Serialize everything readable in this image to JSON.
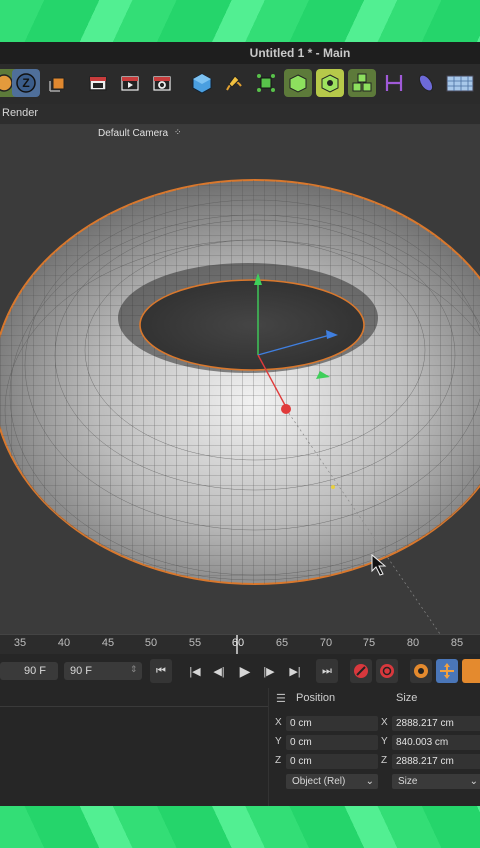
{
  "window": {
    "title": "Untitled 1 * - Main"
  },
  "menubar": {
    "render_label": "Render"
  },
  "viewport": {
    "camera_label": "Default Camera"
  },
  "toolbar": {
    "icons": [
      "mode-icon",
      "z-axis-icon",
      "cube-object-icon",
      "clapboard-icon",
      "render-icon",
      "render-settings-icon",
      "cube-primitive-icon",
      "pen-spline-icon",
      "generator-icon",
      "deformer-icon",
      "subdivision-icon",
      "cloner-icon",
      "measure-icon",
      "capsule-icon",
      "floor-icon"
    ]
  },
  "timeline": {
    "ticks": [
      "35",
      "40",
      "45",
      "50",
      "55",
      "60",
      "65",
      "70",
      "75",
      "80",
      "85"
    ],
    "current": "60"
  },
  "transport": {
    "start_frame": "90 F",
    "end_frame": "90 F"
  },
  "coordinates": {
    "position_header": "Position",
    "size_header": "Size",
    "position": {
      "x": "0 cm",
      "y": "0 cm",
      "z": "0 cm"
    },
    "size": {
      "x": "2888.217 cm",
      "y": "840.003 cm",
      "z": "2888.217 cm"
    },
    "axis_labels": {
      "x": "X",
      "y": "Y",
      "z": "Z"
    },
    "position_mode": "Object (Rel)",
    "size_mode": "Size"
  },
  "colors": {
    "accent_green": "#2fdc72",
    "selection_orange": "#d9782d"
  }
}
